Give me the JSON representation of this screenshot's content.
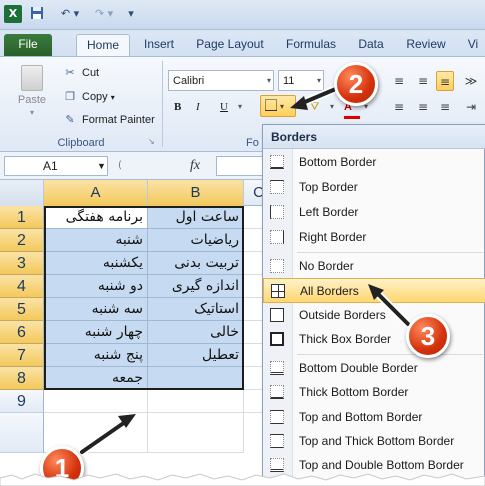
{
  "quick_access": {
    "app_icon": "excel-icon",
    "save_icon": "save-icon",
    "undo_icon": "undo-icon",
    "redo_icon": "redo-icon",
    "more_icon": "qat-more-icon"
  },
  "tabs": {
    "file": "File",
    "home": "Home",
    "insert": "Insert",
    "page_layout": "Page Layout",
    "formulas": "Formulas",
    "data": "Data",
    "review": "Review",
    "view": "Vi"
  },
  "ribbon": {
    "clipboard": {
      "paste": "Paste",
      "cut": "Cut",
      "copy": "Copy",
      "format_painter": "Format Painter",
      "group_label": "Clipboard"
    },
    "font": {
      "font_name": "Calibri",
      "font_size": "11",
      "bold": "B",
      "italic": "I",
      "underline": "U",
      "font_color": "A",
      "group_label": "Fo"
    }
  },
  "formula_bar": {
    "name_box": "A1",
    "fx_label": "fx"
  },
  "grid": {
    "columns": [
      "A",
      "B",
      "C"
    ],
    "rows": [
      {
        "num": "1",
        "a": "برنامه هفتگی",
        "b": "ساعت اول"
      },
      {
        "num": "2",
        "a": "شنبه",
        "b": "ریاضیات"
      },
      {
        "num": "3",
        "a": "یکشنبه",
        "b": "تربیت بدنی"
      },
      {
        "num": "4",
        "a": "دو شنبه",
        "b": "اندازه گیری"
      },
      {
        "num": "5",
        "a": "سه شنبه",
        "b": "استاتیک"
      },
      {
        "num": "6",
        "a": "چهار شنبه",
        "b": "خالی"
      },
      {
        "num": "7",
        "a": "پنج شنبه",
        "b": "تعطیل"
      },
      {
        "num": "8",
        "a": "جمعه",
        "b": ""
      },
      {
        "num": "9",
        "a": "",
        "b": ""
      }
    ]
  },
  "borders_menu": {
    "header": "Borders",
    "items": [
      {
        "label": "Bottom Border",
        "icon": "bottom-border-icon"
      },
      {
        "label": "Top Border",
        "icon": "top-border-icon"
      },
      {
        "label": "Left Border",
        "icon": "left-border-icon"
      },
      {
        "label": "Right Border",
        "icon": "right-border-icon"
      },
      {
        "label": "No Border",
        "icon": "no-border-icon"
      },
      {
        "label": "All Borders",
        "icon": "all-borders-icon",
        "highlighted": true
      },
      {
        "label": "Outside Borders",
        "icon": "outside-borders-icon"
      },
      {
        "label": "Thick Box Border",
        "icon": "thick-box-border-icon"
      },
      {
        "label": "Bottom Double Border",
        "icon": "bottom-double-border-icon"
      },
      {
        "label": "Thick Bottom Border",
        "icon": "thick-bottom-border-icon"
      },
      {
        "label": "Top and Bottom Border",
        "icon": "top-bottom-border-icon"
      },
      {
        "label": "Top and Thick Bottom Border",
        "icon": "top-thick-bottom-border-icon"
      },
      {
        "label": "Top and Double Bottom Border",
        "icon": "top-double-bottom-border-icon"
      }
    ]
  },
  "callouts": {
    "one": "1",
    "two": "2",
    "three": "3"
  },
  "colors": {
    "accent": "#ffcf5a",
    "selection_fill": "#c6dbf1",
    "callout": "#d3310b",
    "file_tab": "#3c7a3e"
  }
}
